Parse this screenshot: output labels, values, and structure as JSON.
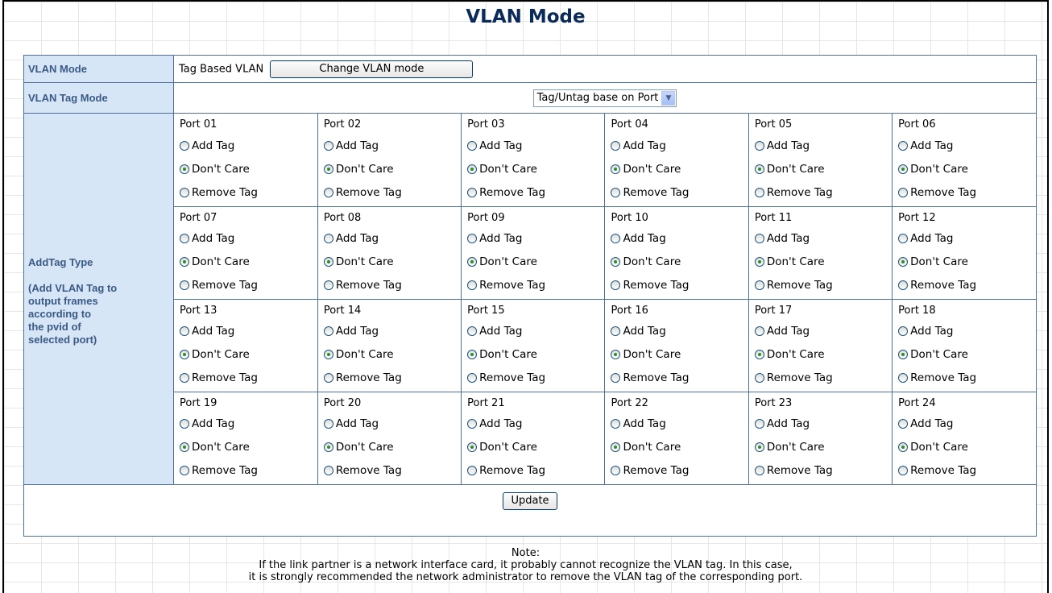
{
  "page": {
    "title": "VLAN Mode"
  },
  "vlan_mode": {
    "label": "VLAN Mode",
    "value": "Tag Based VLAN",
    "change_button": "Change VLAN mode"
  },
  "vlan_tag_mode": {
    "label": "VLAN Tag Mode",
    "selected": "Tag/Untag base on Port"
  },
  "addtag": {
    "label": "AddTag Type",
    "description_lines": [
      "(Add VLAN Tag to",
      "output frames",
      "according to",
      "the pvid of",
      "selected port)"
    ],
    "options": [
      "Add Tag",
      "Don't Care",
      "Remove Tag"
    ],
    "ports": [
      {
        "name": "Port 01",
        "selected": "Don't Care"
      },
      {
        "name": "Port 02",
        "selected": "Don't Care"
      },
      {
        "name": "Port 03",
        "selected": "Don't Care"
      },
      {
        "name": "Port 04",
        "selected": "Don't Care"
      },
      {
        "name": "Port 05",
        "selected": "Don't Care"
      },
      {
        "name": "Port 06",
        "selected": "Don't Care"
      },
      {
        "name": "Port 07",
        "selected": "Don't Care"
      },
      {
        "name": "Port 08",
        "selected": "Don't Care"
      },
      {
        "name": "Port 09",
        "selected": "Don't Care"
      },
      {
        "name": "Port 10",
        "selected": "Don't Care"
      },
      {
        "name": "Port 11",
        "selected": "Don't Care"
      },
      {
        "name": "Port 12",
        "selected": "Don't Care"
      },
      {
        "name": "Port 13",
        "selected": "Don't Care"
      },
      {
        "name": "Port 14",
        "selected": "Don't Care"
      },
      {
        "name": "Port 15",
        "selected": "Don't Care"
      },
      {
        "name": "Port 16",
        "selected": "Don't Care"
      },
      {
        "name": "Port 17",
        "selected": "Don't Care"
      },
      {
        "name": "Port 18",
        "selected": "Don't Care"
      },
      {
        "name": "Port 19",
        "selected": "Don't Care"
      },
      {
        "name": "Port 20",
        "selected": "Don't Care"
      },
      {
        "name": "Port 21",
        "selected": "Don't Care"
      },
      {
        "name": "Port 22",
        "selected": "Don't Care"
      },
      {
        "name": "Port 23",
        "selected": "Don't Care"
      },
      {
        "name": "Port 24",
        "selected": "Don't Care"
      }
    ]
  },
  "update_button": "Update",
  "note": {
    "heading": "Note:",
    "line1": "If the link partner is a network interface card, it probably cannot recognize the VLAN tag. In this case,",
    "line2": "it is strongly recommended the network administrator to remove the VLAN tag of the corresponding port."
  },
  "colors": {
    "label_bg": "#d6e6f7",
    "label_text": "#3a5a84",
    "border": "#4d6f9a",
    "title": "#0a2a5a",
    "radio_dot": "#2c8c2c"
  }
}
